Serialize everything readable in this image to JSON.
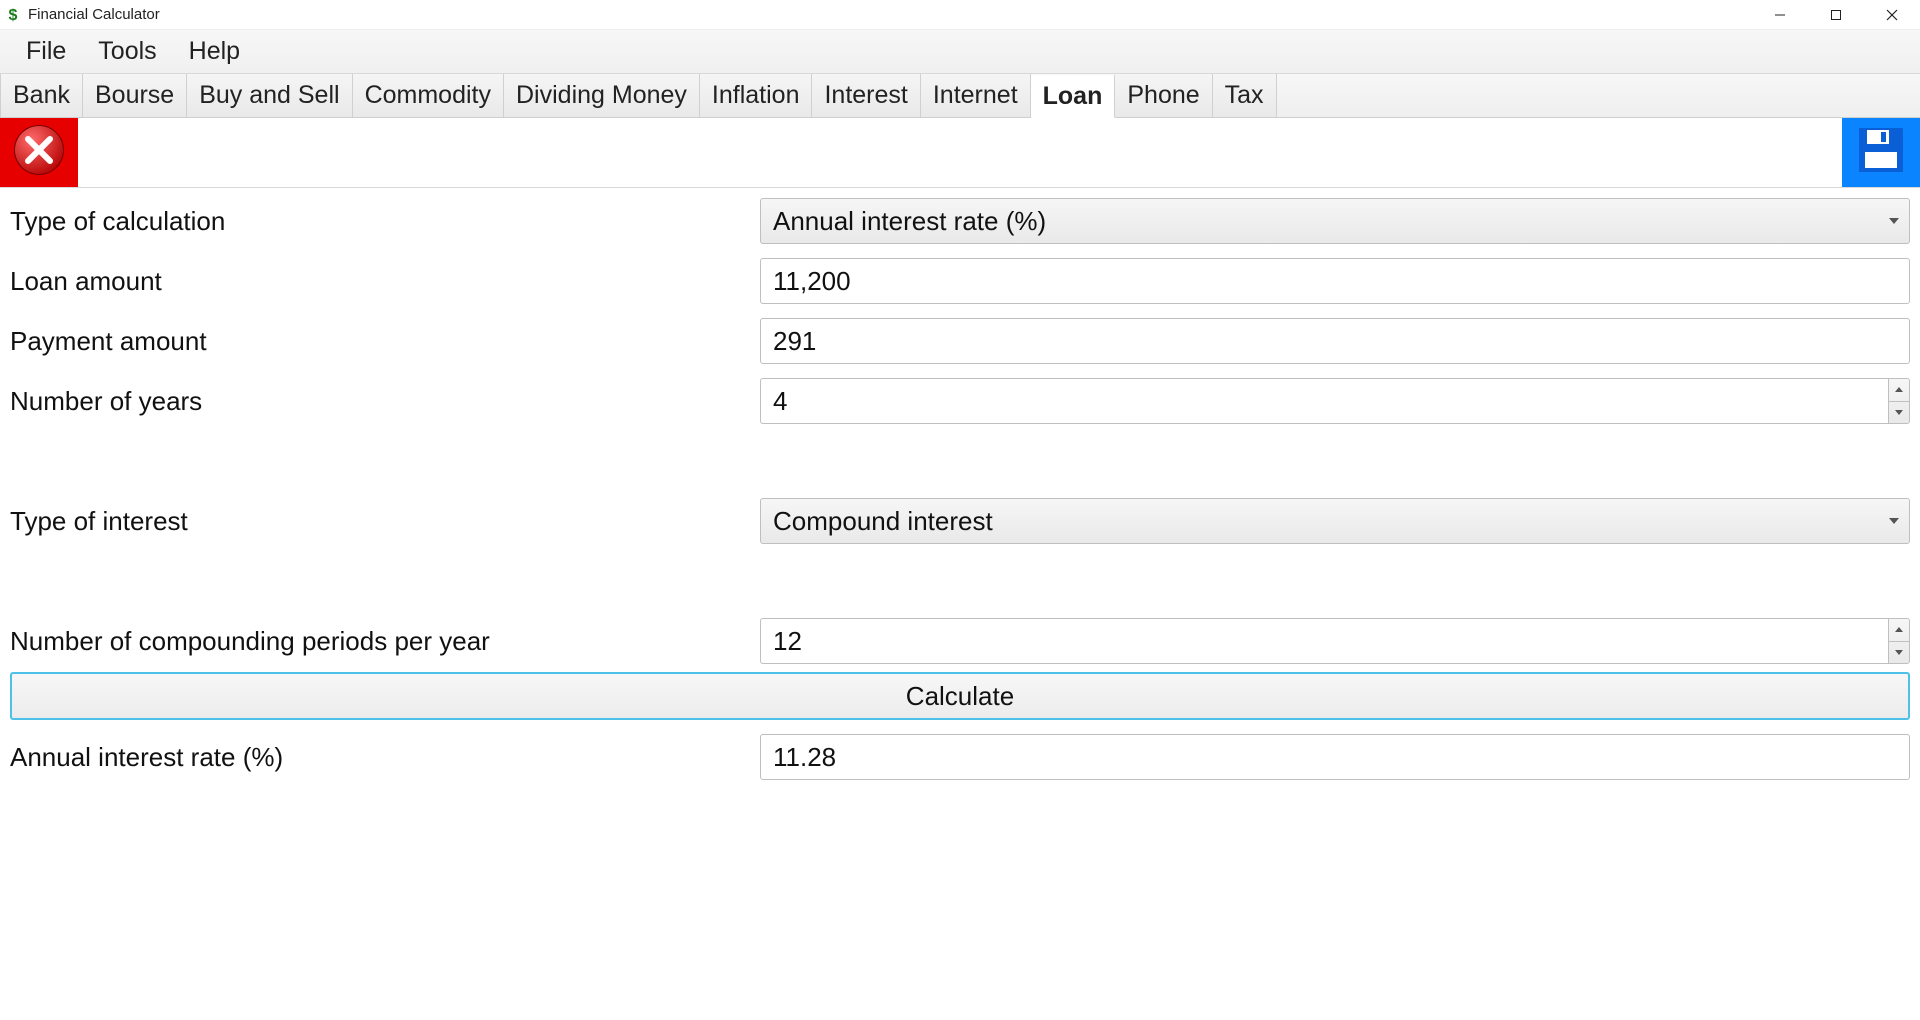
{
  "window": {
    "title": "Financial Calculator"
  },
  "menu": {
    "items": [
      "File",
      "Tools",
      "Help"
    ]
  },
  "tabs": {
    "items": [
      "Bank",
      "Bourse",
      "Buy and Sell",
      "Commodity",
      "Dividing Money",
      "Inflation",
      "Interest",
      "Internet",
      "Loan",
      "Phone",
      "Tax"
    ],
    "active": "Loan"
  },
  "form": {
    "type_of_calculation": {
      "label": "Type of calculation",
      "value": "Annual interest rate (%)"
    },
    "loan_amount": {
      "label": "Loan amount",
      "value": "11,200"
    },
    "payment_amount": {
      "label": "Payment amount",
      "value": "291"
    },
    "number_of_years": {
      "label": "Number of years",
      "value": "4"
    },
    "type_of_interest": {
      "label": "Type of interest",
      "value": "Compound interest"
    },
    "compounding_periods": {
      "label": "Number of compounding periods per year",
      "value": "12"
    },
    "calculate_label": "Calculate",
    "result": {
      "label": "Annual interest rate (%)",
      "value": "11.28"
    }
  }
}
